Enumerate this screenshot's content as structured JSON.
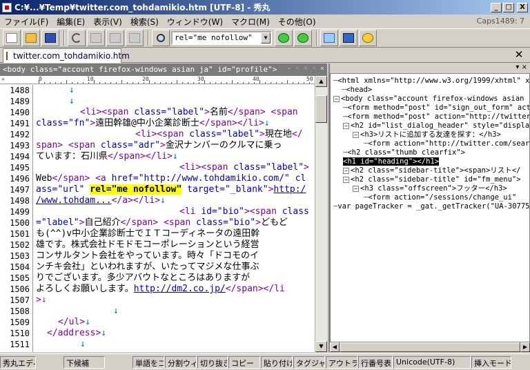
{
  "window": {
    "title": "C:¥...¥Temp¥twitter.com_tohdamikio.htm [UTF-8] - 秀丸",
    "minimize": "_",
    "maximize": "□",
    "close": "X"
  },
  "menu": {
    "items": [
      "ファイル(F)",
      "編集(E)",
      "表示(V)",
      "検索(S)",
      "ウィンドウ(W)",
      "マクロ(M)",
      "その他(O)"
    ],
    "caps": "Caps1489: 7"
  },
  "toolbar": {
    "search_value": "rel=\"me nofollow\"",
    "icons": [
      "new-file-icon",
      "open-folder-icon",
      "save-icon",
      "undo-icon",
      "copy-icon",
      "cut-icon",
      "paste-icon",
      "search-icon",
      "find-next-down-icon",
      "find-next-up-icon",
      "window-icon",
      "split-icon",
      "settings-icon"
    ]
  },
  "tabs": [
    {
      "label": "twitter.com_tohdamikio.htm",
      "active": true
    }
  ],
  "editor": {
    "header": "<body class=\"account firefox-windows asian ja\" id=\"profile\">",
    "ruler_marks": [
      "0",
      "10",
      "20",
      "30",
      "40",
      "50"
    ],
    "line_numbers": [
      "1488",
      "1489",
      "1490",
      "1491",
      "1492",
      "1493",
      "1494",
      "1495",
      "1496",
      "1497",
      "1498",
      "1499",
      "1500",
      "1501",
      "1502",
      "1503",
      "1504",
      "1505",
      "1506",
      "1507",
      "1508",
      "1509",
      "1510",
      "1511"
    ],
    "highlight": "rel=\"me nofollow\""
  },
  "tree": {
    "nodes": [
      "<html xmlns=\"http://www.w3.org/1999/xhtml\" x",
      "<head>",
      "<body class=\"account firefox-windows asian j",
      "<form method=\"post\" id=\"sign_out_form\" act",
      "<form method=\"post\" action=\"http://twitter",
      "<h2 id=\"list_dialog_header\" style=\"display",
      "<h3>リストに追加する友達を探す：</h3>",
      "<form action=\"http://twitter.com/sear",
      "<h2 class=\"thumb clearfix\">",
      "<h1 id=\"heading\"></h1>",
      "<h2 class=\"sidebar-title\"><span>リスト</",
      "<h2 class=\"sidebar-title\" id=\"fm_menu\">",
      "<h3 class=\"offscreen\">フッター</h3>",
      "<form action=\"/sessions/change_ui\"",
      "var pageTracker = _gat._getTracker(\"UA-30775"
    ]
  },
  "status": {
    "items": [
      "秀丸エディ",
      "下候補",
      "単語をコ",
      "分割ウィ",
      "切り抜き",
      "コピー",
      "貼り付け",
      "タグジャンプ",
      "アウトライン",
      "行番号表",
      "Unicode(UTF-8)",
      "挿入モード"
    ]
  }
}
